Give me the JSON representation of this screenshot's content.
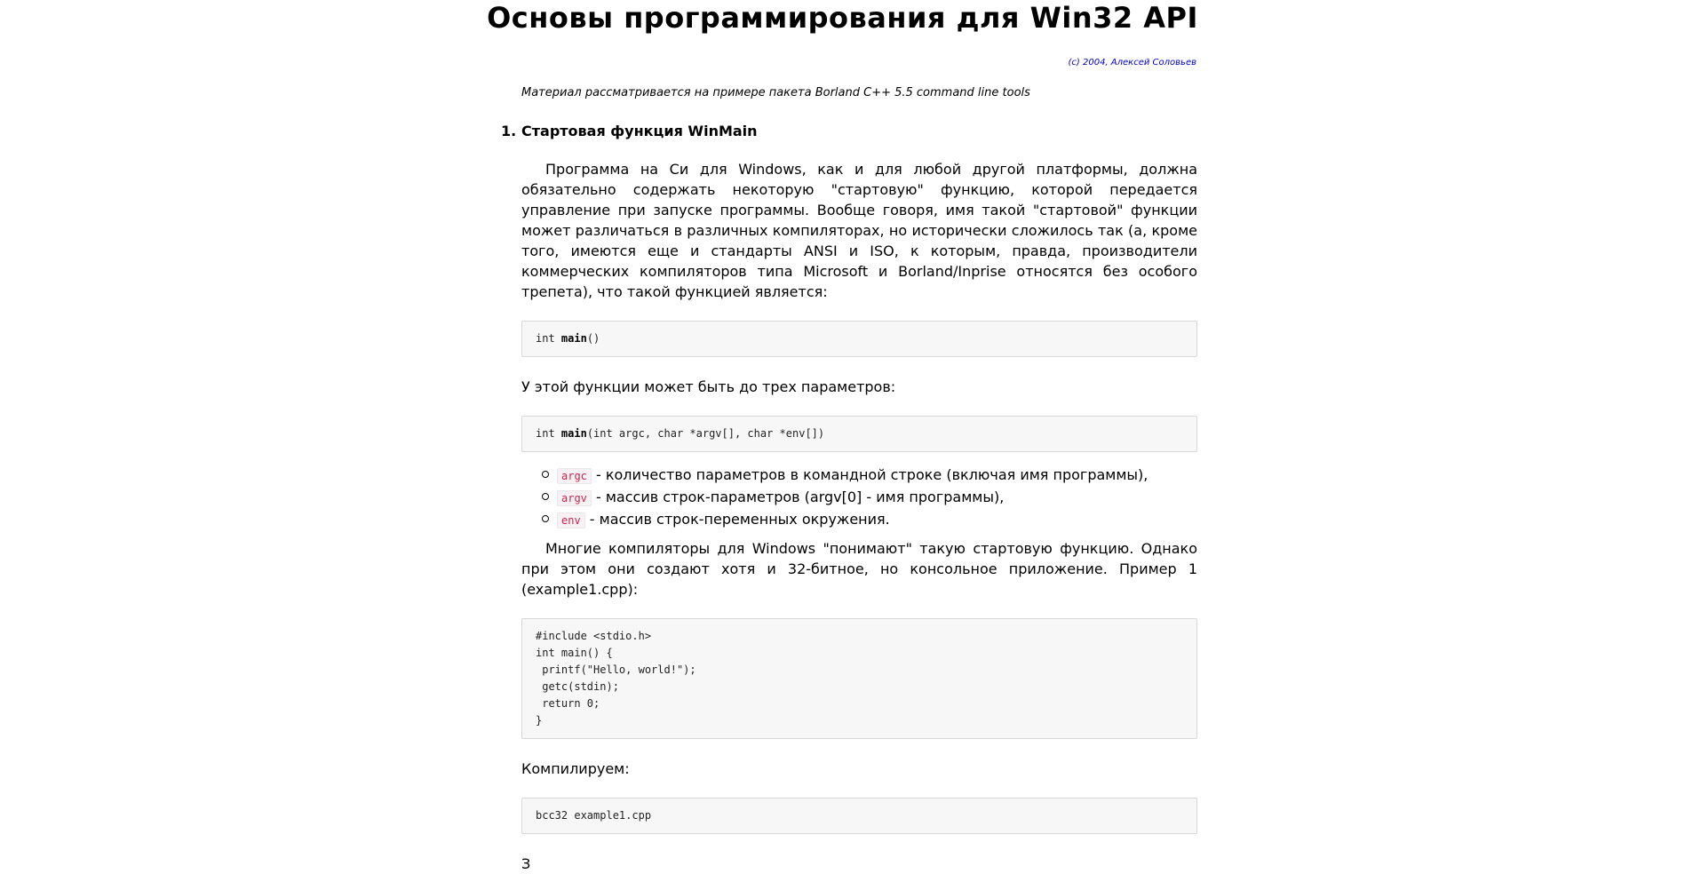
{
  "page": {
    "title": "Основы программирования для Win32 API",
    "copyright": "(c) 2004, Алексей Соловьев",
    "subtitle": "Материал рассматривается на примере пакета Borland C++ 5.5 command line tools"
  },
  "section1": {
    "number": "1.",
    "heading": "Стартовая функция WinMain",
    "intro_paragraph": "Программа на Си для Windows, как и для любой другой платформы, должна обязательно содержать некоторую \"стартовую\" функцию, которой передается управление при запуске программы. Вообще говоря, имя такой \"стартовой\" функции может различаться в различных компиляторах, но исторически сложилось так (а, кроме того, имеются еще и стандарты ANSI и ISO, к которым, правда, производители коммерческих компиляторов типа Microsoft и Borland/Inprise относятся без особого трепета), что такой функцией является:",
    "code1": {
      "prefix": "int ",
      "name": "main",
      "suffix": "()"
    },
    "params_intro": "У этой функции может быть до трех параметров:",
    "code2": {
      "prefix": "int ",
      "name": "main",
      "suffix": "(int argc, char *argv[], char *env[])"
    },
    "params": [
      {
        "name": "argc",
        "desc": " - количество параметров в командной строке (включая имя программы),"
      },
      {
        "name": "argv",
        "desc": " - массив строк-параметров (argv[0] - имя программы),"
      },
      {
        "name": "env",
        "desc": " - массив строк-переменных окружения."
      }
    ],
    "compilers_paragraph": "Многие компиляторы для Windows \"понимают\" такую стартовую функцию. Однако при этом они создают хотя и 32-битное, но консольное приложение. Пример 1 (example1.cpp):",
    "example1_code": "#include <stdio.h>\nint main() {\n printf(\"Hello, world!\");\n getc(stdin);\n return 0;\n}",
    "compile_label": "Компилируем:",
    "compile_command": "bcc32 example1.cpp",
    "cut_text": "З"
  }
}
